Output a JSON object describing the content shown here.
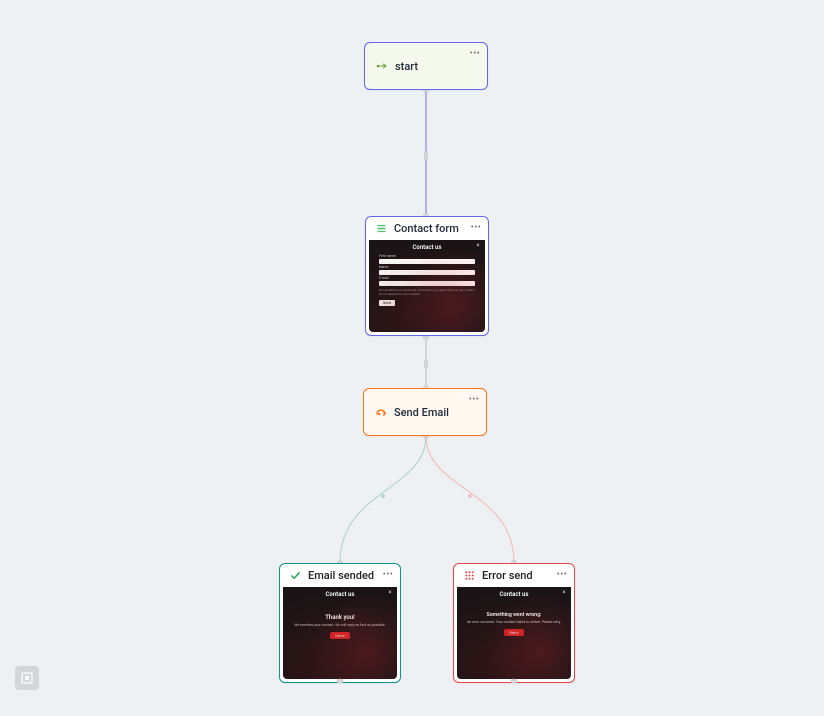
{
  "nodes": {
    "start": {
      "label": "start"
    },
    "contact": {
      "label": "Contact form",
      "preview": {
        "title": "Contact us",
        "fields": [
          {
            "label": "First name"
          },
          {
            "label": "Name"
          },
          {
            "label": "E-mail"
          }
        ],
        "consent": "By submitting your personal information, you agree that we may contact you to respond to your request.",
        "submit": "Send"
      }
    },
    "send": {
      "label": "Send Email"
    },
    "success": {
      "label": "Email sended",
      "preview": {
        "title": "Contact us",
        "headline": "Thank you!",
        "body": "We received your contact. We will reply as fast as possible.",
        "button": "Done"
      }
    },
    "error": {
      "label": "Error send",
      "preview": {
        "title": "Contact us",
        "headline": "Something went wrong:",
        "body": "An error occurred. Your contact failed to deliver. Please retry.",
        "button": "Retry"
      }
    }
  },
  "colors": {
    "accent_start": "#6366f1",
    "accent_send": "#f97316",
    "accent_success": "#0d9488",
    "accent_error": "#ef4444"
  }
}
